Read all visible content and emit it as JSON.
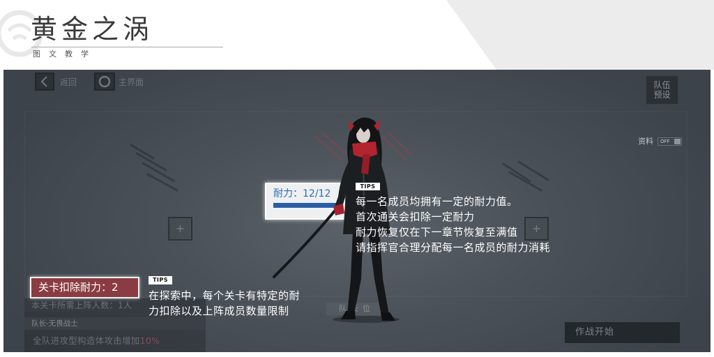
{
  "header": {
    "title": "黄金之涡",
    "subtitle": "图文教学"
  },
  "game": {
    "back": {
      "label": "返回",
      "icon": "chevron-left-icon"
    },
    "home": {
      "label": "主界面",
      "icon": "circle-home-icon"
    },
    "team_preset": [
      "队伍",
      "预设"
    ],
    "info": {
      "label": "资料",
      "toggle": "OFF"
    },
    "slots": [
      {
        "icon": "plus-icon",
        "symbol": "+"
      },
      {
        "icon": "plus-icon",
        "symbol": "+"
      }
    ],
    "stamina": {
      "label": "耐力：12/12",
      "current": 12,
      "max": 12
    },
    "level_cost": "关卡扣除耐力：2",
    "required_members": "本关卡所需上阵人数：1人",
    "captain": {
      "skill_name": "队长-无畏战士",
      "skill_desc": "全队进攻型构造体攻击增加",
      "skill_value": "10%"
    },
    "captain_slot": "队长位",
    "start_button": "作战开始"
  },
  "tips": [
    {
      "tag": "TIPS",
      "lines": [
        "每一名成员均拥有一定的耐力值。",
        "首次通关会扣除一定耐力",
        "耐力恢复仅在下一章节恢复至满值",
        "请指挥官合理分配每一名成员的耐力消耗"
      ]
    },
    {
      "tag": "TIPS",
      "lines": [
        "在探索中，每个关卡有特定的耐",
        "力扣除以及上阵成员数量限制"
      ]
    }
  ],
  "colors": {
    "stamina_text": "#2e6cb2",
    "stamina_bar": "#2b5da6",
    "level_cost_bg": "#8a3c42",
    "bonus_value": "#8c4a4d"
  }
}
